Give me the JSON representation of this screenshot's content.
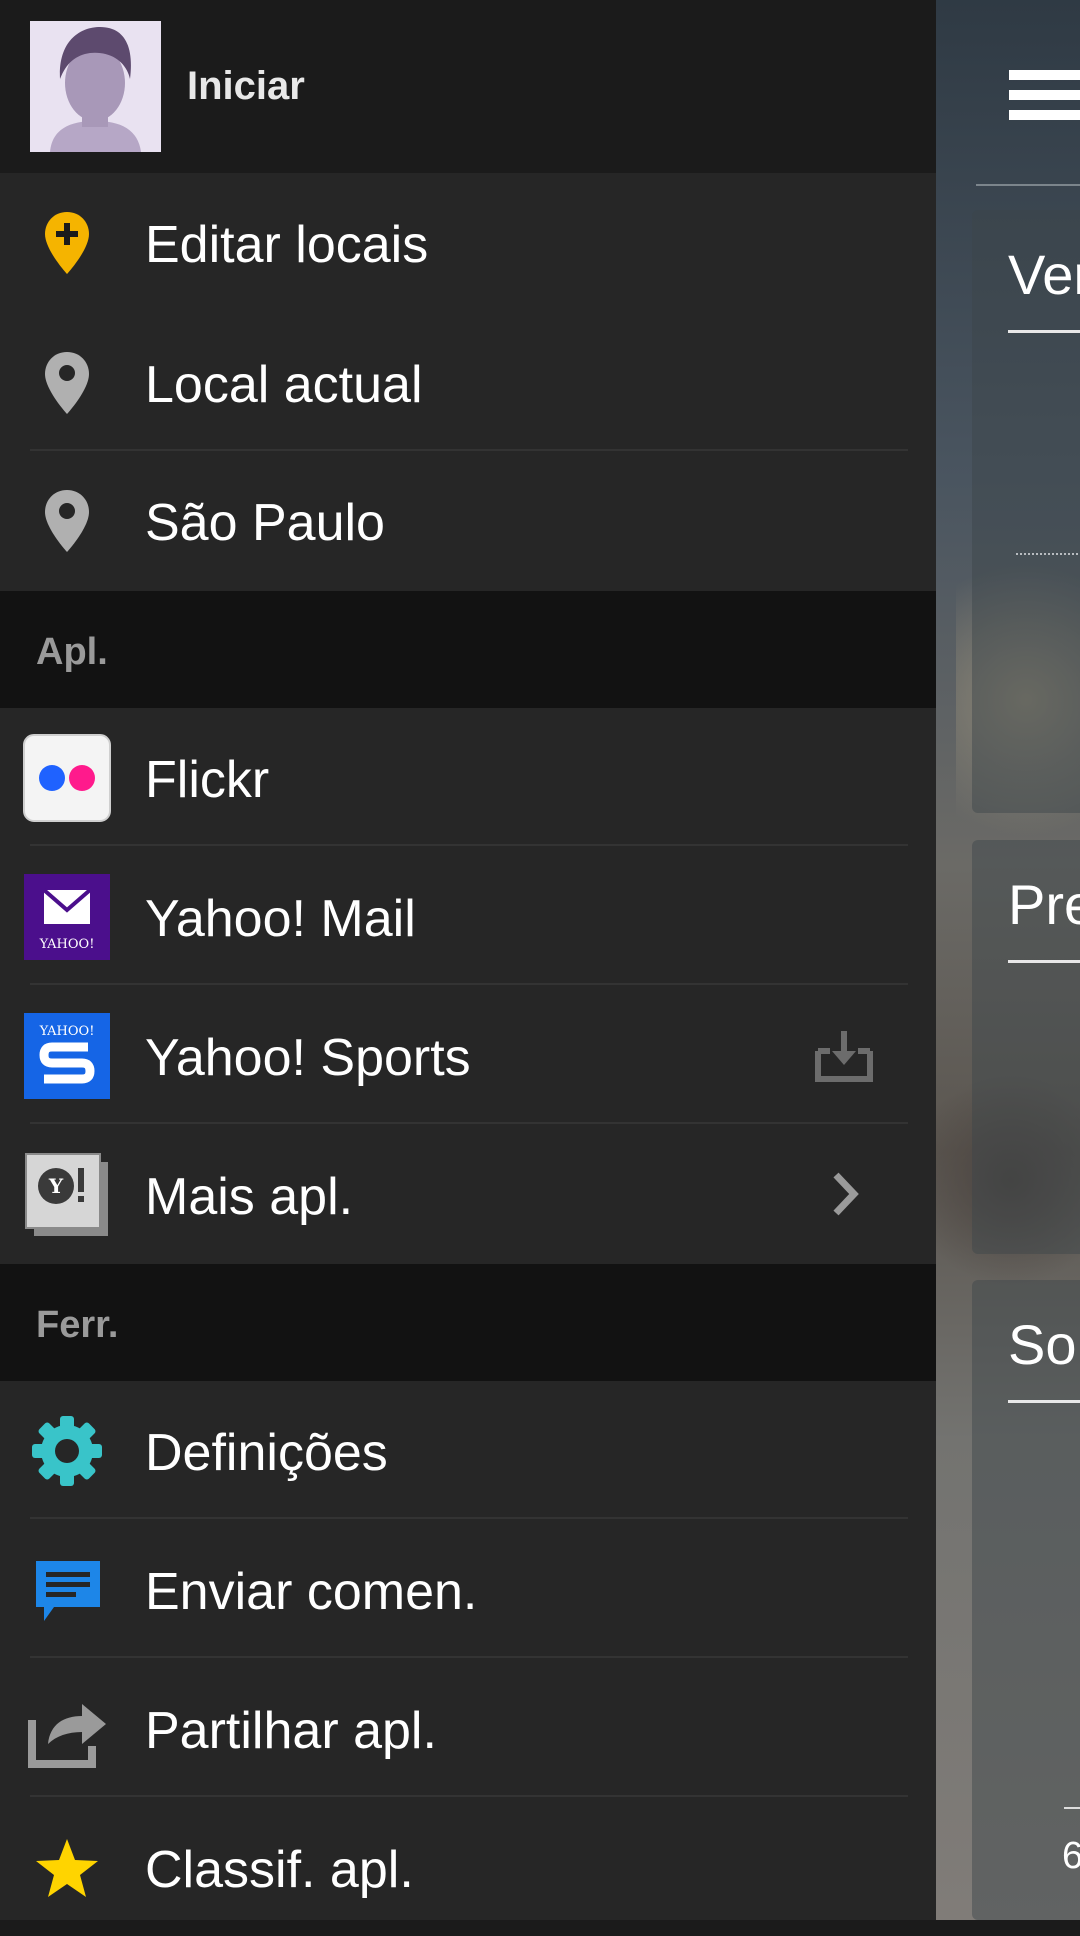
{
  "drawer": {
    "profile": {
      "name": "Iniciar"
    },
    "locations": [
      {
        "label": "Editar locais",
        "icon": "add-location-icon"
      },
      {
        "label": "Local actual",
        "icon": "location-pin-icon"
      },
      {
        "label": "São Paulo",
        "icon": "location-pin-icon"
      }
    ],
    "apps_section": {
      "title": "Apl.",
      "items": [
        {
          "label": "Flickr",
          "icon": "flickr-icon"
        },
        {
          "label": "Yahoo! Mail",
          "icon": "yahoo-mail-icon",
          "icon_text": "YAHOO!"
        },
        {
          "label": "Yahoo! Sports",
          "icon": "yahoo-sports-icon",
          "icon_text": "YAHOO!",
          "action_icon": "download-icon"
        },
        {
          "label": "Mais apl.",
          "icon": "yahoo-apps-icon",
          "action_icon": "chevron-right-icon"
        }
      ]
    },
    "tools_section": {
      "title": "Ferr.",
      "items": [
        {
          "label": "Definições",
          "icon": "gear-icon"
        },
        {
          "label": "Enviar comen.",
          "icon": "feedback-icon"
        },
        {
          "label": "Partilhar apl.",
          "icon": "share-icon"
        },
        {
          "label": "Classif. apl.",
          "icon": "star-icon"
        }
      ]
    }
  },
  "background_app": {
    "cards": [
      {
        "title": "Ver"
      },
      {
        "title": "Pre"
      },
      {
        "title": "Sol"
      }
    ],
    "bottom_label": "6"
  },
  "colors": {
    "drawer_bg": "#262626",
    "header_bg": "#1b1b1b",
    "section_bg": "#121212",
    "pin_yellow": "#f5b400",
    "pin_gray": "#b0b0b0",
    "flickr_blue": "#1f62ff",
    "flickr_pink": "#ff1a8c",
    "yahoo_purple": "#4b0f8c",
    "sports_blue": "#1565e6",
    "gear_teal": "#39c4c9",
    "feedback_blue": "#1d86e8",
    "star_yellow": "#ffd400"
  }
}
